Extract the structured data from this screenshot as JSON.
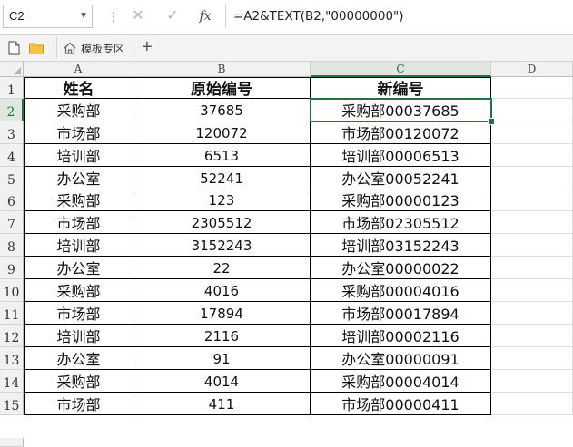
{
  "formula_bar": {
    "cell_ref": "C2",
    "formula": "=A2&TEXT(B2,\"00000000\")",
    "fx_label": "fx"
  },
  "tab_bar": {
    "tab_label": "模板专区",
    "add_label": "+"
  },
  "columns": [
    "A",
    "B",
    "C",
    "D"
  ],
  "selected_cell": "C2",
  "sheet": {
    "headers": [
      "姓名",
      "原始编号",
      "新编号"
    ],
    "rows": [
      {
        "n": "2",
        "a": "采购部",
        "b": "37685",
        "c": "采购部00037685"
      },
      {
        "n": "3",
        "a": "市场部",
        "b": "120072",
        "c": "市场部00120072"
      },
      {
        "n": "4",
        "a": "培训部",
        "b": "6513",
        "c": "培训部00006513"
      },
      {
        "n": "5",
        "a": "办公室",
        "b": "52241",
        "c": "办公室00052241"
      },
      {
        "n": "6",
        "a": "采购部",
        "b": "123",
        "c": "采购部00000123"
      },
      {
        "n": "7",
        "a": "市场部",
        "b": "2305512",
        "c": "市场部02305512"
      },
      {
        "n": "8",
        "a": "培训部",
        "b": "3152243",
        "c": "培训部03152243"
      },
      {
        "n": "9",
        "a": "办公室",
        "b": "22",
        "c": "办公室00000022"
      },
      {
        "n": "10",
        "a": "采购部",
        "b": "4016",
        "c": "采购部00004016"
      },
      {
        "n": "11",
        "a": "市场部",
        "b": "17894",
        "c": "市场部00017894"
      },
      {
        "n": "12",
        "a": "培训部",
        "b": "2116",
        "c": "培训部00002116"
      },
      {
        "n": "13",
        "a": "办公室",
        "b": "91",
        "c": "办公室00000091"
      },
      {
        "n": "14",
        "a": "采购部",
        "b": "4014",
        "c": "采购部00004014"
      },
      {
        "n": "15",
        "a": "市场部",
        "b": "411",
        "c": "市场部00000411"
      }
    ]
  },
  "colors": {
    "selection": "#217346",
    "header_bg": "#f1f1f1",
    "gridline": "#000000"
  }
}
